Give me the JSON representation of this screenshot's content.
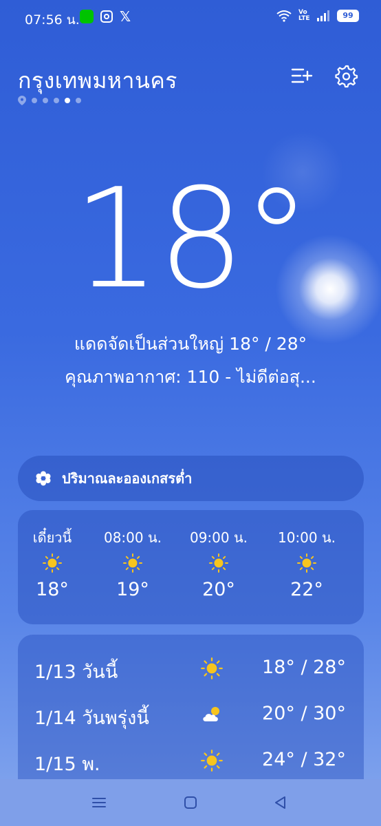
{
  "status_bar": {
    "time": "07:56 น.",
    "battery": "99",
    "network_label": "Vo LTE"
  },
  "header": {
    "city": "กรุงเทพมหานคร",
    "page_count": 5,
    "active_page": 4
  },
  "current": {
    "temperature": "18°",
    "condition_line": "แดดจัดเป็นส่วนใหญ่  18° / 28°",
    "aqi_line": "คุณภาพอากาศ: 110 - ไม่ดีต่อสุ..."
  },
  "alert": {
    "text": "ปริมาณละอองเกสรต่ำ",
    "icon": "pollen-icon"
  },
  "hourly": [
    {
      "label": "เดี๋ยวนี้",
      "temp": "18°",
      "icon": "sun-icon"
    },
    {
      "label": "08:00 น.",
      "temp": "19°",
      "icon": "sun-icon"
    },
    {
      "label": "09:00 น.",
      "temp": "20°",
      "icon": "sun-icon"
    },
    {
      "label": "10:00 น.",
      "temp": "22°",
      "icon": "sun-icon"
    }
  ],
  "daily": [
    {
      "label": "1/13 วันนี้",
      "range": "18° / 28°",
      "icon": "sun-icon"
    },
    {
      "label": "1/14 วันพรุ่งนี้",
      "range": "20° / 30°",
      "icon": "partly-cloudy-icon"
    },
    {
      "label": "1/15 พ.",
      "range": "24° / 32°",
      "icon": "sun-icon"
    }
  ],
  "colors": {
    "sun": "#f7c51e",
    "cloud": "#ffffff",
    "background_top": "#2f5dd6"
  }
}
